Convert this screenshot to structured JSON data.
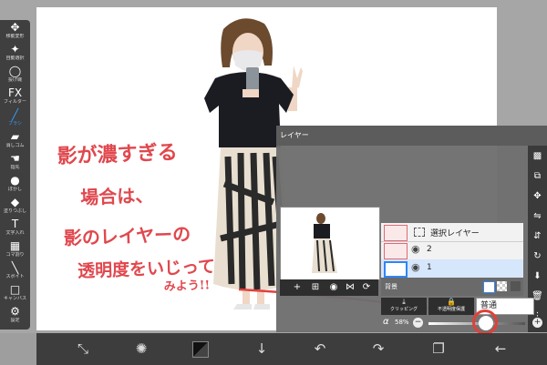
{
  "toolbar": {
    "tools": [
      {
        "label": "移動変形",
        "icon": "move-icon",
        "glyph": "✥"
      },
      {
        "label": "自動選択",
        "icon": "magic-wand-icon",
        "glyph": "✦"
      },
      {
        "label": "投げ縄",
        "icon": "lasso-icon",
        "glyph": "◯"
      },
      {
        "label": "フィルター",
        "icon": "filter-icon",
        "glyph": "FX"
      },
      {
        "label": "ブラシ",
        "icon": "brush-icon",
        "glyph": "╱"
      },
      {
        "label": "消しゴム",
        "icon": "eraser-icon",
        "glyph": "▰"
      },
      {
        "label": "指先",
        "icon": "smudge-icon",
        "glyph": "☚"
      },
      {
        "label": "ぼかし",
        "icon": "blur-icon",
        "glyph": "●"
      },
      {
        "label": "塗りつぶし",
        "icon": "fill-icon",
        "glyph": "◆"
      },
      {
        "label": "文字入れ",
        "icon": "text-icon",
        "glyph": "T"
      },
      {
        "label": "コマ割り",
        "icon": "frame-divider-icon",
        "glyph": "▦"
      },
      {
        "label": "スポイト",
        "icon": "eyedropper-icon",
        "glyph": "╲"
      },
      {
        "label": "キャンバス",
        "icon": "canvas-icon",
        "glyph": "□"
      },
      {
        "label": "設定",
        "icon": "gear-icon",
        "glyph": "⚙"
      }
    ]
  },
  "annotation": {
    "line1": "影が濃すぎる",
    "line2": "場合は、",
    "line3": "影のレイヤーの",
    "line4": "透明度をいじって",
    "line5": "みよう!!"
  },
  "layer_panel": {
    "title": "レイヤー",
    "layers": [
      {
        "name": "選択レイヤー",
        "selected": false
      },
      {
        "name": "2",
        "selected": false
      },
      {
        "name": "1",
        "selected": true
      }
    ],
    "background_label": "背景",
    "clipping_label": "クリッピング",
    "lock_label": "不透明度保護",
    "blend_mode": "普通",
    "opacity_symbol": "α",
    "opacity_value": "58%",
    "opacity_fraction": 0.58,
    "minus": "−",
    "plus": "+"
  },
  "colors": {
    "accent": "#3a9cff",
    "annotation_red": "#e0484e",
    "highlight_ring": "#e2403a"
  }
}
